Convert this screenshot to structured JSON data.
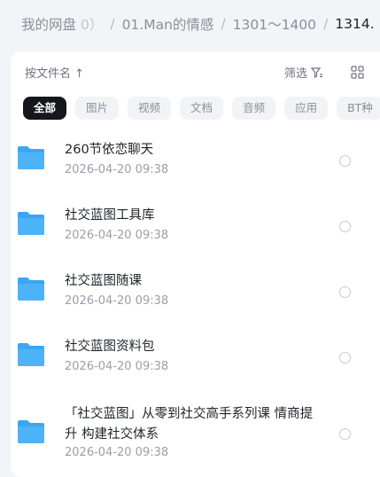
{
  "breadcrumb": {
    "root": "我的网盘",
    "root_count": "0）",
    "level1": "01.Man的情感",
    "level2": "1301～1400",
    "current": "1314."
  },
  "toolbar": {
    "sort_label": "按文件名",
    "filter_label": "筛选"
  },
  "tabs": [
    "全部",
    "图片",
    "视频",
    "文档",
    "音频",
    "应用",
    "BT种"
  ],
  "files": [
    {
      "name": "260节依恋聊天",
      "date": "2026-04-20  09:38"
    },
    {
      "name": "社交蓝图工具库",
      "date": "2026-04-20  09:38"
    },
    {
      "name": "社交蓝图随课",
      "date": "2026-04-20  09:38"
    },
    {
      "name": "社交蓝图资料包",
      "date": "2026-04-20  09:38"
    },
    {
      "name": "「社交蓝图」从零到社交高手系列课 情商提升 构建社交体系",
      "date": "2026-04-20  09:38"
    }
  ],
  "icons": {
    "folder": "folder-icon",
    "sort_arrow": "arrow-up-icon",
    "filter": "filter-icon",
    "grid": "grid-view-icon",
    "select": "radio-circle-icon"
  },
  "colors": {
    "folder": "#3aa6f5",
    "active_tab": "#15171c"
  }
}
